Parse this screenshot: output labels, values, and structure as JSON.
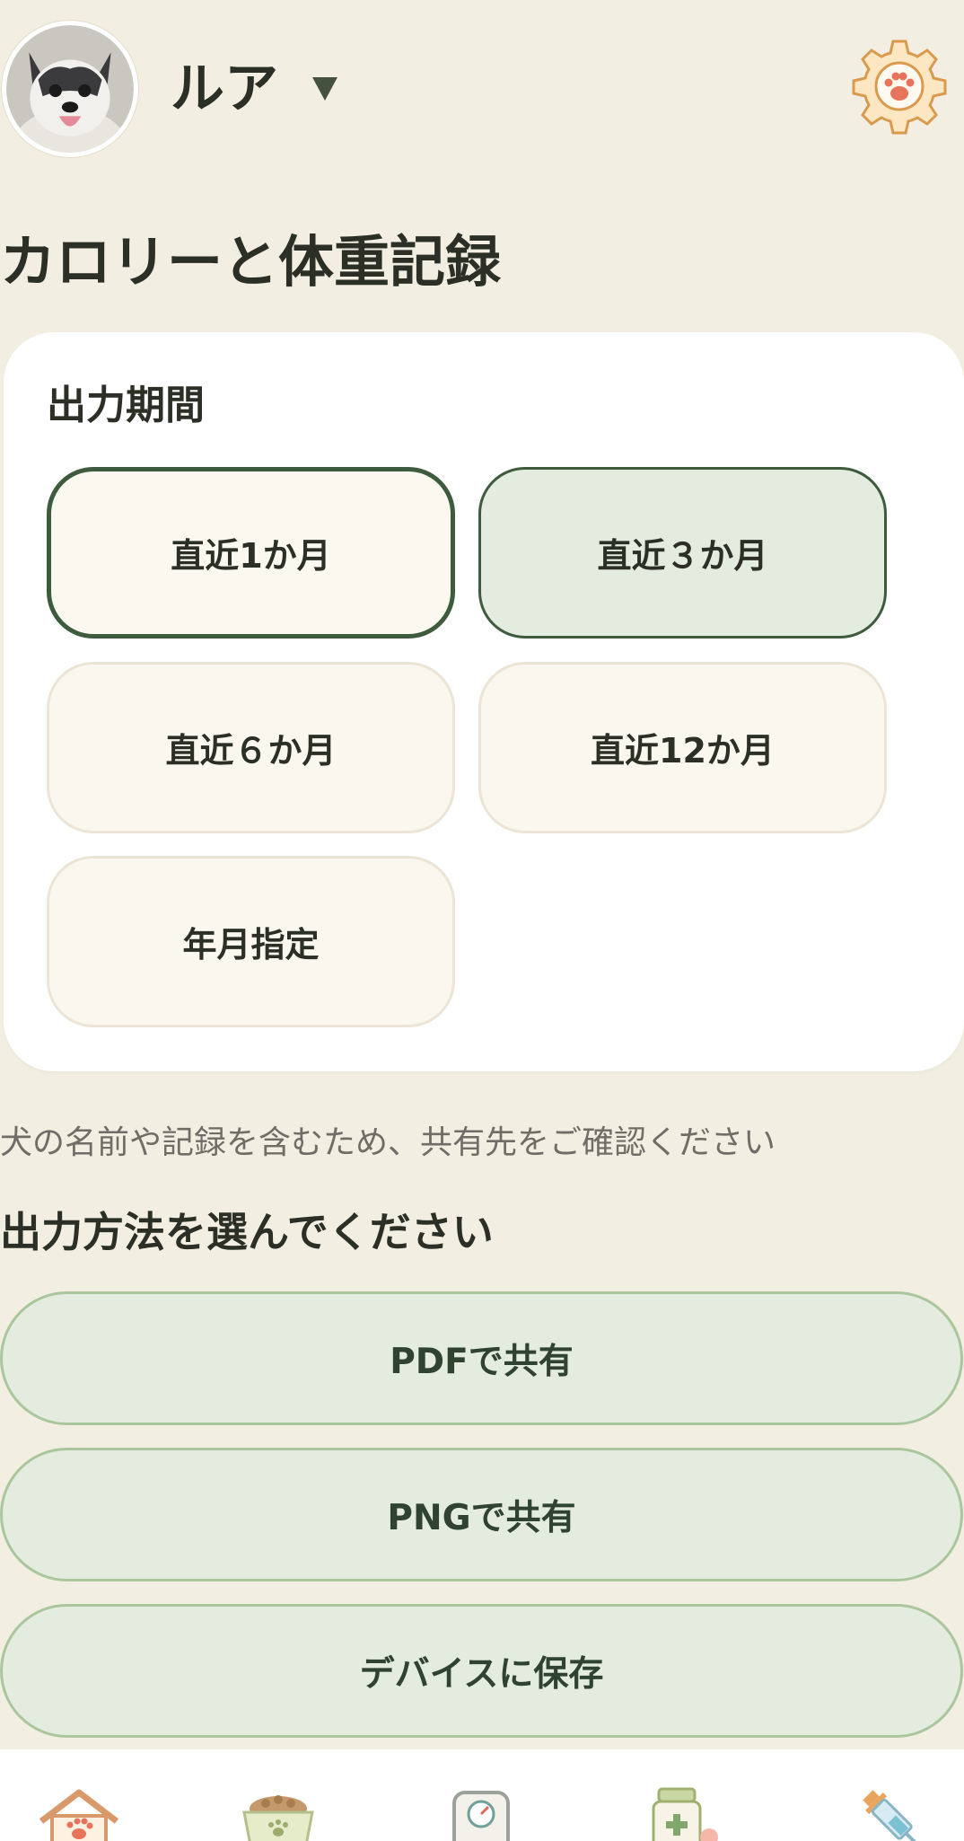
{
  "header": {
    "pet_name": "ルア",
    "avatar_icon": "dog-avatar",
    "dropdown_icon": "caret-down-icon",
    "settings_icon": "paw-gear-icon"
  },
  "page": {
    "title": "カロリーと体重記録"
  },
  "period": {
    "title": "出力期間",
    "options": [
      {
        "label": "直近1か月",
        "state": "selected"
      },
      {
        "label": "直近３か月",
        "state": "highlighted"
      },
      {
        "label": "直近６か月",
        "state": "default"
      },
      {
        "label": "直近12か月",
        "state": "default"
      },
      {
        "label": "年月指定",
        "state": "default"
      }
    ]
  },
  "note": "犬の名前や記録を含むため、共有先をご確認ください",
  "output": {
    "title": "出力方法を選んでください",
    "actions": [
      {
        "label": "PDFで共有"
      },
      {
        "label": "PNGで共有"
      },
      {
        "label": "デバイスに保存"
      }
    ]
  },
  "nav": {
    "icons": [
      "house-paw-icon",
      "food-bowl-icon",
      "scale-icon",
      "medicine-bottle-icon",
      "syringe-icon"
    ]
  },
  "colors": {
    "background": "#f2eee2",
    "card": "#ffffff",
    "selected_border": "#3e5b3e",
    "highlight_fill": "#e4ecdf",
    "action_border": "#a9c69c",
    "accent_orange": "#f0b46a"
  }
}
